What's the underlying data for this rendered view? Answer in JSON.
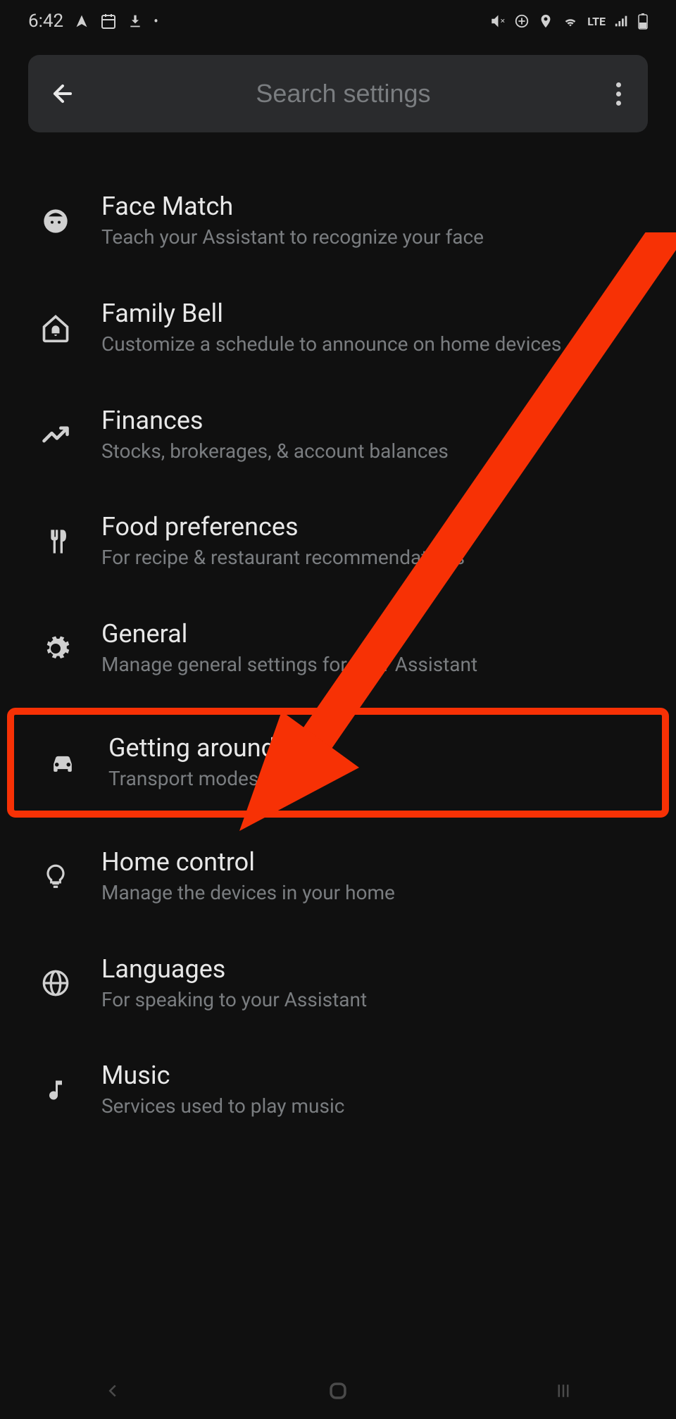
{
  "status": {
    "time": "6:42",
    "lte": "LTE"
  },
  "search": {
    "placeholder": "Search settings"
  },
  "items": [
    {
      "title": "Face Match",
      "subtitle": "Teach your Assistant to recognize your face"
    },
    {
      "title": "Family Bell",
      "subtitle": "Customize a schedule to announce on home devices"
    },
    {
      "title": "Finances",
      "subtitle": "Stocks, brokerages, & account balances"
    },
    {
      "title": "Food preferences",
      "subtitle": "For recipe & restaurant recommendations"
    },
    {
      "title": "General",
      "subtitle": "Manage general settings for your Assistant"
    },
    {
      "title": "Getting around",
      "subtitle": "Transport modes"
    },
    {
      "title": "Home control",
      "subtitle": "Manage the devices in your home"
    },
    {
      "title": "Languages",
      "subtitle": "For speaking to your Assistant"
    },
    {
      "title": "Music",
      "subtitle": "Services used to play music"
    }
  ]
}
